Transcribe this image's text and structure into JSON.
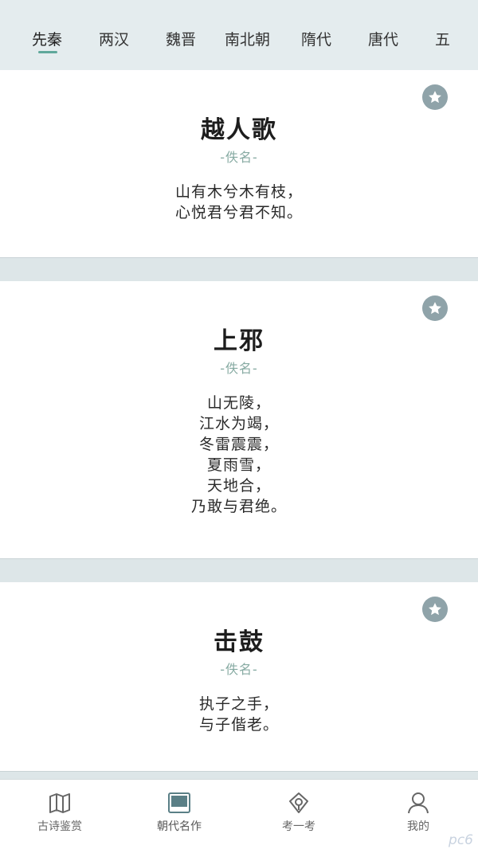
{
  "tabs": [
    {
      "label": "先秦",
      "active": true
    },
    {
      "label": "两汉",
      "active": false
    },
    {
      "label": "魏晋",
      "active": false
    },
    {
      "label": "南北朝",
      "active": false
    },
    {
      "label": "隋代",
      "active": false
    },
    {
      "label": "唐代",
      "active": false
    },
    {
      "label": "五",
      "active": false
    }
  ],
  "poems": [
    {
      "title": "越人歌",
      "author": "-佚名-",
      "lines": [
        "山有木兮木有枝，",
        "心悦君兮君不知。"
      ]
    },
    {
      "title": "上邪",
      "author": "-佚名-",
      "lines": [
        "山无陵，",
        "江水为竭，",
        "冬雷震震，",
        "夏雨雪，",
        "天地合，",
        "乃敢与君绝。"
      ]
    },
    {
      "title": "击鼓",
      "author": "-佚名-",
      "lines": [
        "执子之手，",
        "与子偕老。"
      ]
    }
  ],
  "bottom_nav": [
    {
      "label": "古诗鉴赏",
      "icon": "book-map-icon",
      "active": false
    },
    {
      "label": "朝代名作",
      "icon": "album-icon",
      "active": true
    },
    {
      "label": "考一考",
      "icon": "quiz-badge-icon",
      "active": false
    },
    {
      "label": "我的",
      "icon": "user-icon",
      "active": false
    }
  ],
  "watermark": "pc6",
  "colors": {
    "accent": "#5fa89b",
    "author": "#86aaa2",
    "star": "#8fa3a9",
    "background": "#dde6e8"
  }
}
